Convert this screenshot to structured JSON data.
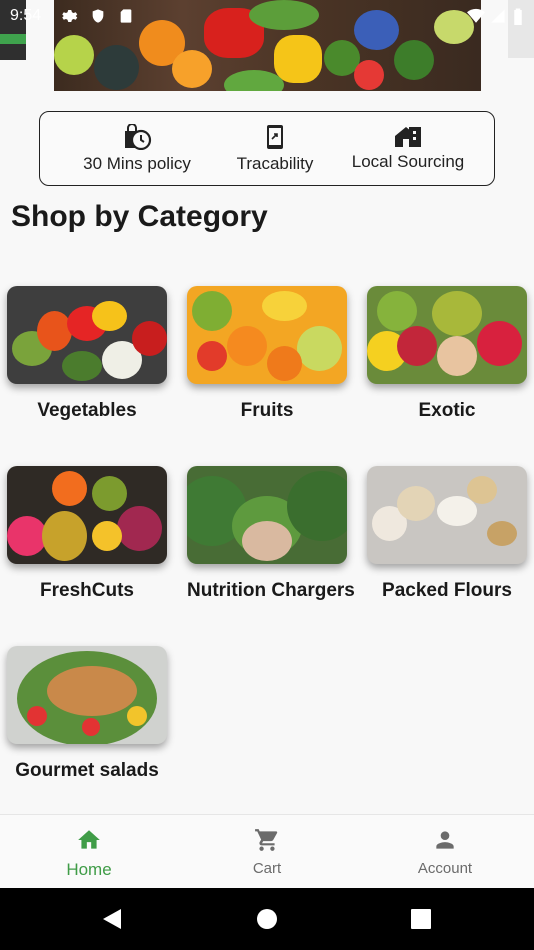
{
  "status_bar": {
    "time": "9:54"
  },
  "features": [
    {
      "label": "30 Mins policy",
      "icon": "timer-bag-icon"
    },
    {
      "label": "Tracability",
      "icon": "phone-share-icon"
    },
    {
      "label": "Local Sourcing",
      "icon": "home-building-icon"
    }
  ],
  "section_title": "Shop by Category",
  "categories": [
    {
      "label": "Vegetables"
    },
    {
      "label": "Fruits"
    },
    {
      "label": "Exotic"
    },
    {
      "label": "FreshCuts"
    },
    {
      "label": "Nutrition Chargers"
    },
    {
      "label": "Packed Flours"
    },
    {
      "label": "Gourmet salads"
    }
  ],
  "bottom_nav": {
    "home": "Home",
    "cart": "Cart",
    "account": "Account",
    "active_color": "#3f9c47",
    "inactive_color": "#6b6b6b"
  }
}
